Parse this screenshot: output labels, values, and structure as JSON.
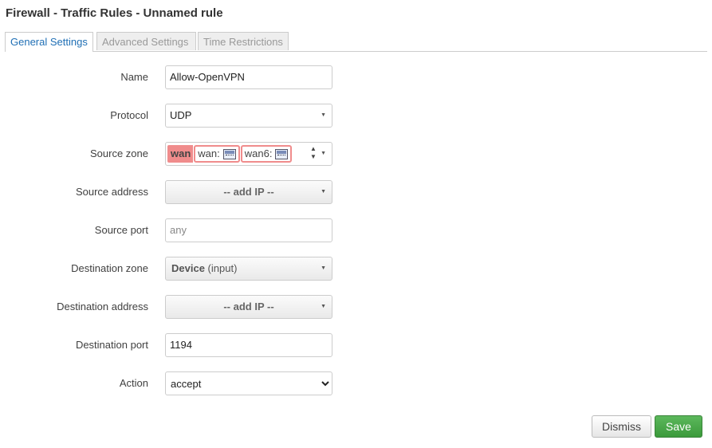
{
  "dialog": {
    "title": "Firewall - Traffic Rules - Unnamed rule"
  },
  "tabs": [
    {
      "label": "General Settings",
      "active": true
    },
    {
      "label": "Advanced Settings",
      "active": false
    },
    {
      "label": "Time Restrictions",
      "active": false
    }
  ],
  "form": {
    "name": {
      "label": "Name",
      "value": "Allow-OpenVPN"
    },
    "protocol": {
      "label": "Protocol",
      "value": "UDP"
    },
    "source_zone": {
      "label": "Source zone",
      "zone": "wan",
      "chips": [
        "wan:",
        "wan6:"
      ]
    },
    "source_address": {
      "label": "Source address",
      "value": "-- add IP --"
    },
    "source_port": {
      "label": "Source port",
      "placeholder": "any"
    },
    "destination_zone": {
      "label": "Destination zone",
      "value": "Device",
      "value_suffix": "(input)"
    },
    "destination_address": {
      "label": "Destination address",
      "value": "-- add IP --"
    },
    "destination_port": {
      "label": "Destination port",
      "value": "1194"
    },
    "action": {
      "label": "Action",
      "value": "accept",
      "options": [
        "accept"
      ]
    }
  },
  "buttons": {
    "dismiss": "Dismiss",
    "save": "Save"
  },
  "colors": {
    "zone_wan": "#f08c8c",
    "save": "#4cae4c",
    "tab_active": "#1f6fb5"
  }
}
